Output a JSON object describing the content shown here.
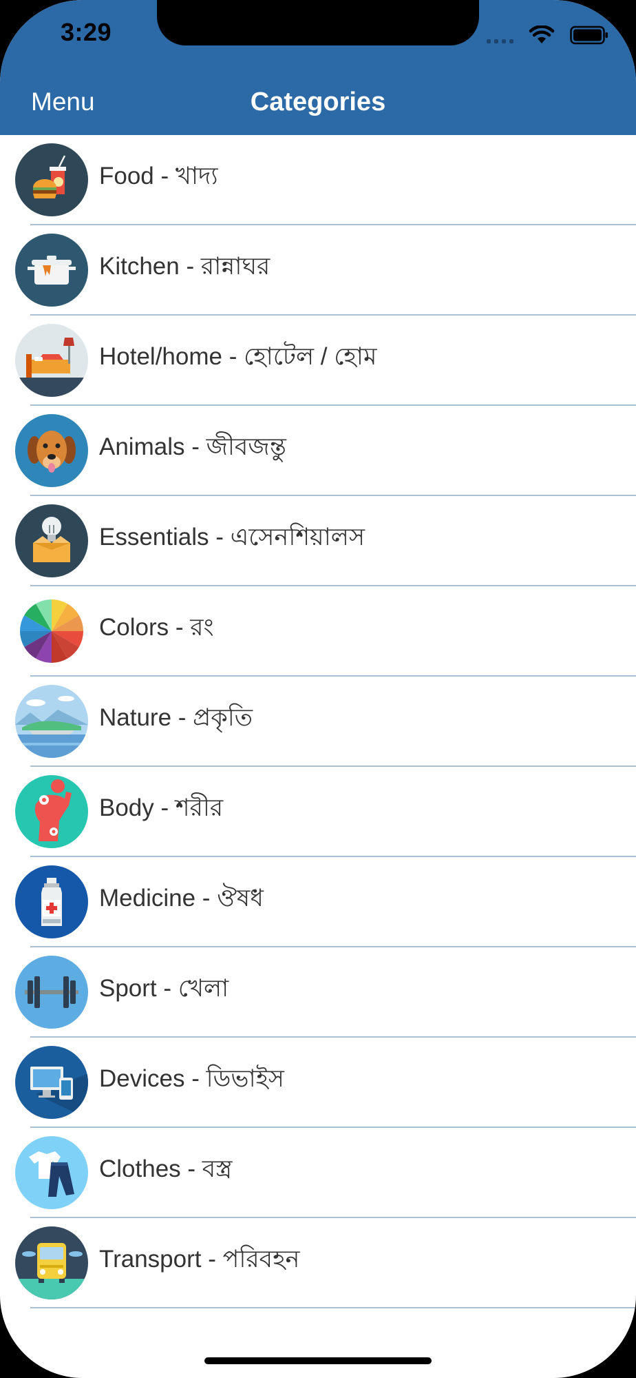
{
  "status_bar": {
    "time": "3:29"
  },
  "nav": {
    "menu_label": "Menu",
    "title": "Categories"
  },
  "theme": {
    "header_color": "#2c69a7",
    "separator_color": "#a8bfd6",
    "label_color": "#333333"
  },
  "categories": [
    {
      "label": "Food - খাদ্য",
      "icon": "food-icon"
    },
    {
      "label": "Kitchen - রান্নাঘর",
      "icon": "kitchen-icon"
    },
    {
      "label": "Hotel/home - হোটেল / হোম",
      "icon": "hotel-home-icon"
    },
    {
      "label": "Animals - জীবজন্তু",
      "icon": "animals-icon"
    },
    {
      "label": "Essentials - এসেনশিয়ালস",
      "icon": "essentials-icon"
    },
    {
      "label": "Colors - রং",
      "icon": "colors-icon"
    },
    {
      "label": "Nature - প্রকৃতি",
      "icon": "nature-icon"
    },
    {
      "label": "Body - শরীর",
      "icon": "body-icon"
    },
    {
      "label": "Medicine - ঔষধ",
      "icon": "medicine-icon"
    },
    {
      "label": "Sport - খেলা",
      "icon": "sport-icon"
    },
    {
      "label": "Devices - ডিভাইস",
      "icon": "devices-icon"
    },
    {
      "label": "Clothes - বস্ত্র",
      "icon": "clothes-icon"
    },
    {
      "label": "Transport - পরিবহন",
      "icon": "transport-icon"
    }
  ]
}
